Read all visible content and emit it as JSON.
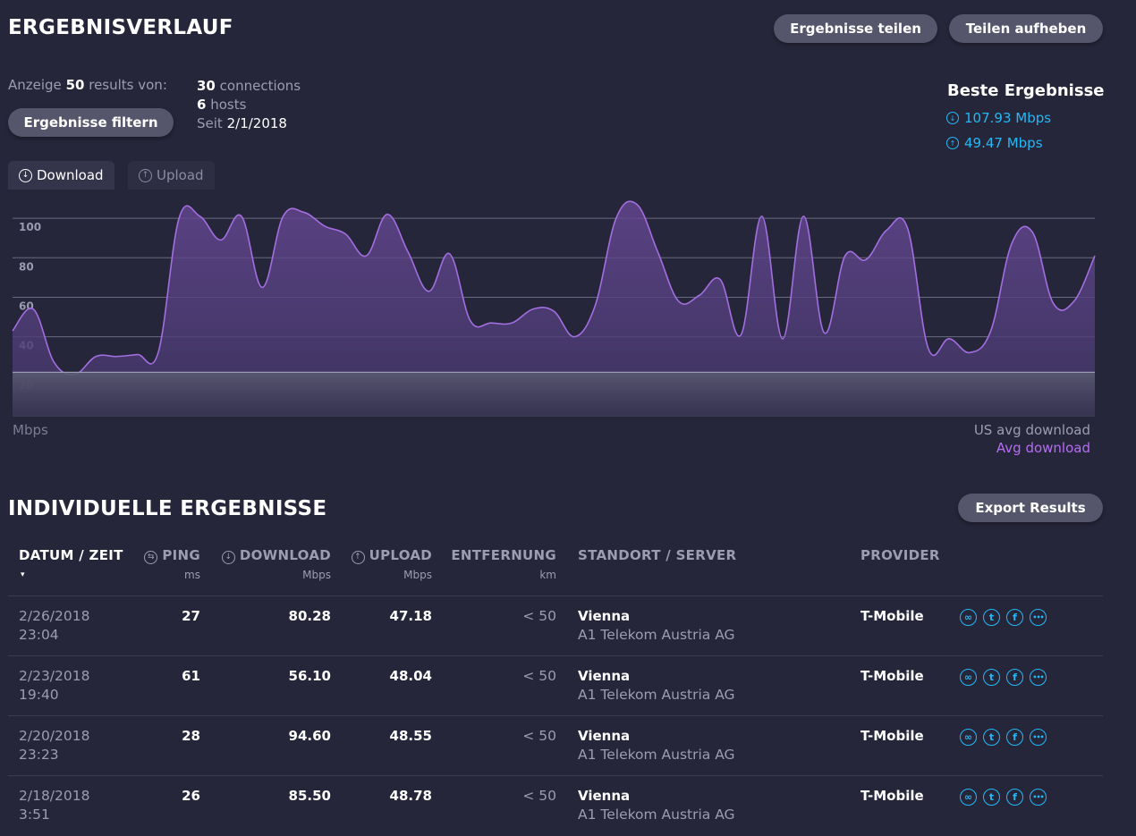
{
  "header": {
    "title": "ERGEBNISVERLAUF",
    "share_label": "Ergebnisse teilen",
    "unshare_label": "Teilen aufheben"
  },
  "summary": {
    "showing_prefix": "Anzeige",
    "showing_count": "50",
    "showing_suffix": "results von:",
    "connections_count": "30",
    "connections_label": "connections",
    "hosts_count": "6",
    "hosts_label": "hosts",
    "since_label": "Seit",
    "since_date": "2/1/2018",
    "filter_label": "Ergebnisse filtern"
  },
  "best": {
    "title": "Beste Ergebnisse",
    "download": "107.93 Mbps",
    "upload": "49.47 Mbps"
  },
  "tabs": [
    {
      "label": "Download",
      "icon": "arrow-down-circle-icon",
      "active": true
    },
    {
      "label": "Upload",
      "icon": "arrow-up-circle-icon",
      "active": false
    }
  ],
  "chart_data": {
    "type": "area",
    "ylabel": "Mbps",
    "yticks": [
      20,
      40,
      60,
      80,
      100
    ],
    "ylim": [
      0,
      110
    ],
    "series": [
      {
        "name": "Avg download",
        "color": "#a26ee0",
        "values": [
          43,
          54,
          27,
          21,
          30,
          30,
          31,
          32,
          100,
          101,
          89,
          101,
          65,
          101,
          103,
          96,
          92,
          81,
          102,
          83,
          63,
          82,
          48,
          47,
          47,
          54,
          53,
          40,
          56,
          100,
          107,
          83,
          58,
          61,
          69,
          41,
          101,
          39,
          101,
          42,
          81,
          79,
          94,
          95,
          34,
          39,
          32,
          43,
          87,
          93,
          57,
          58,
          81
        ]
      },
      {
        "name": "US avg download",
        "color": "#8a8aa0",
        "values": [
          22
        ]
      }
    ],
    "legend": [
      "US avg download",
      "Avg download"
    ],
    "legend_colors": [
      "#9d9db1",
      "#b66cf3"
    ]
  },
  "results": {
    "title": "INDIVIDUELLE ERGEBNISSE",
    "export_label": "Export Results",
    "columns": [
      {
        "label": "DATUM / ZEIT",
        "unit": "▾"
      },
      {
        "label": "PING",
        "unit": "ms",
        "icon": "ping-icon"
      },
      {
        "label": "DOWNLOAD",
        "unit": "Mbps",
        "icon": "arrow-down-circle-icon"
      },
      {
        "label": "UPLOAD",
        "unit": "Mbps",
        "icon": "arrow-up-circle-icon"
      },
      {
        "label": "ENTFERNUNG",
        "unit": "km"
      },
      {
        "label": "STANDORT / SERVER",
        "unit": ""
      },
      {
        "label": "PROVIDER",
        "unit": ""
      }
    ],
    "rows": [
      {
        "date": "2/26/2018",
        "time": "23:04",
        "ping": "27",
        "download": "80.28",
        "upload": "47.18",
        "distance": "< 50",
        "location": "Vienna",
        "server": "A1 Telekom Austria AG",
        "provider": "T-Mobile"
      },
      {
        "date": "2/23/2018",
        "time": "19:40",
        "ping": "61",
        "download": "56.10",
        "upload": "48.04",
        "distance": "< 50",
        "location": "Vienna",
        "server": "A1 Telekom Austria AG",
        "provider": "T-Mobile"
      },
      {
        "date": "2/20/2018",
        "time": "23:23",
        "ping": "28",
        "download": "94.60",
        "upload": "48.55",
        "distance": "< 50",
        "location": "Vienna",
        "server": "A1 Telekom Austria AG",
        "provider": "T-Mobile"
      },
      {
        "date": "2/18/2018",
        "time": "3:51",
        "ping": "26",
        "download": "85.50",
        "upload": "48.78",
        "distance": "< 50",
        "location": "Vienna",
        "server": "A1 Telekom Austria AG",
        "provider": "T-Mobile"
      }
    ],
    "share_icons": [
      "link-icon",
      "twitter-icon",
      "facebook-icon",
      "more-icon"
    ]
  }
}
